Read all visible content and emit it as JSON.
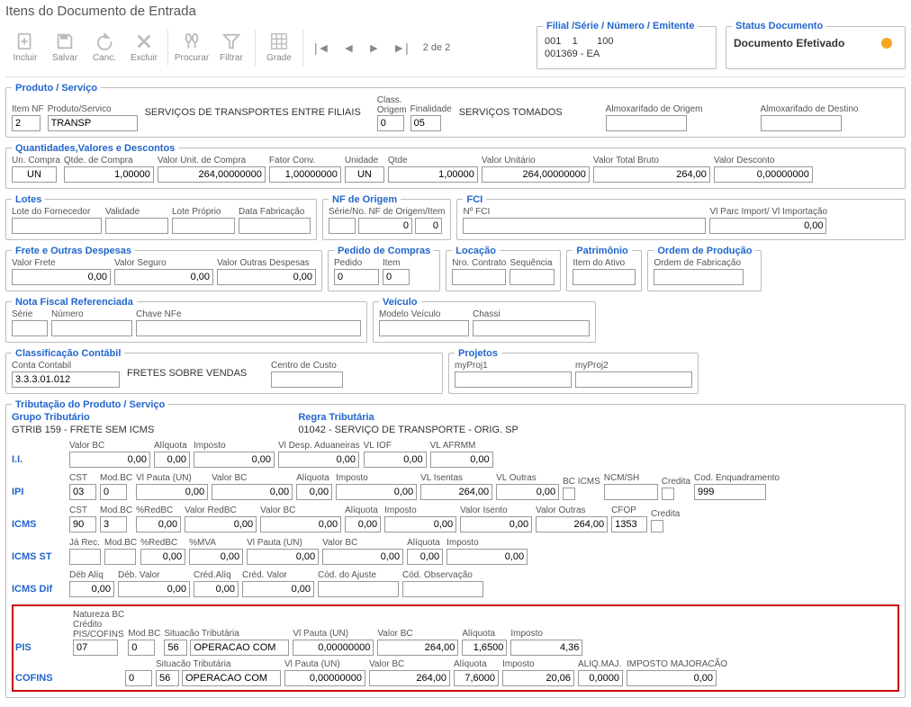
{
  "title": "Itens do Documento de Entrada",
  "toolbar": {
    "incluir": "Incluir",
    "salvar": "Salvar",
    "canc": "Canc.",
    "excluir": "Excluir",
    "procurar": "Procurar",
    "filtrar": "Filtrar",
    "grade": "Grade",
    "nav_count": "2 de 2"
  },
  "filial": {
    "legend": "Filial /Série / Número / Emitente",
    "line1_a": "001",
    "line1_b": "1",
    "line1_c": "100",
    "line2": "001369 - EA"
  },
  "status": {
    "legend": "Status Documento",
    "text": "Documento Efetivado"
  },
  "produto": {
    "legend": "Produto / Serviço",
    "item_nf_label": "Item NF",
    "item_nf": "2",
    "produto_label": "Produto/Servico",
    "produto": "TRANSP",
    "produto_desc": "SERVIÇOS DE TRANSPORTES ENTRE FILIAIS",
    "class_origem_label1": "Class.",
    "class_origem_label2": "Origem",
    "class_origem": "0",
    "finalidade_label": "Finalidade",
    "finalidade": "05",
    "finalidade_desc": "SERVIÇOS TOMADOS",
    "almox_origem_label": "Almoxarifado de Origem",
    "almox_origem": "",
    "almox_destino_label": "Almoxarifado de Destino",
    "almox_destino": ""
  },
  "qvd": {
    "legend": "Quantidades,Valores e Descontos",
    "un_compra_label": "Un. Compra",
    "un_compra": "UN",
    "qtde_compra_label": "Qtde. de Compra",
    "qtde_compra": "1,00000",
    "valor_unit_label": "Valor Unit. de Compra",
    "valor_unit": "264,00000000",
    "fator_conv_label": "Fator Conv.",
    "fator_conv": "1,00000000",
    "unidade_label": "Unidade",
    "unidade": "UN",
    "qtde_label": "Qtde",
    "qtde": "1,00000",
    "valor_unitario_label": "Valor Unitário",
    "valor_unitario": "264,00000000",
    "valor_total_label": "Valor Total Bruto",
    "valor_total": "264,00",
    "valor_desc_label": "Valor  Desconto",
    "valor_desc": "0,00000000"
  },
  "lotes": {
    "legend": "Lotes",
    "lote_forn_label": "Lote do Fornecedor",
    "validade_label": "Validade",
    "lote_proprio_label": "Lote Próprio",
    "data_fab_label": "Data Fabricação"
  },
  "nforigem": {
    "legend": "NF de Origem",
    "serie_no_label": "Série/No. NF de Origem/Item",
    "serie": "",
    "no": "0",
    "item": "0"
  },
  "fci": {
    "legend": "FCI",
    "nofci_label": "Nº FCI",
    "vlparc_label": "Vl Parc Import/ Vl Importação",
    "vlparc": "0,00"
  },
  "frete": {
    "legend": "Frete e Outras Despesas",
    "valor_frete_label": "Valor Frete",
    "valor_frete": "0,00",
    "valor_seguro_label": "Valor Seguro",
    "valor_seguro": "0,00",
    "valor_outras_label": "Valor Outras Despesas",
    "valor_outras": "0,00"
  },
  "pedido": {
    "legend": "Pedido de Compras",
    "pedido_label": "Pedido",
    "pedido": "0",
    "item_label": "Item",
    "item": "0"
  },
  "locacao": {
    "legend": "Locação",
    "nro_label": "Nro. Contrato",
    "seq_label": "Sequência"
  },
  "patrimonio": {
    "legend": "Patrimônio",
    "item_label": "Item do Ativo"
  },
  "ordemprod": {
    "legend": "Ordem de Produção",
    "ordem_label": "Ordem de Fabricação"
  },
  "nfref": {
    "legend": "Nota Fiscal Referenciada",
    "serie_label": "Série",
    "numero_label": "Número",
    "chave_label": "Chave NFe"
  },
  "veiculo": {
    "legend": "Veículo",
    "modelo_label": "Modelo Veículo",
    "chassi_label": "Chassi"
  },
  "classif": {
    "legend": "Classificação Contábil",
    "conta_label": "Conta Contabil",
    "conta": "3.3.3.01.012",
    "conta_desc": "FRETES SOBRE VENDAS",
    "centro_label": "Centro de Custo"
  },
  "projetos": {
    "legend": "Projetos",
    "p1_label": "myProj1",
    "p2_label": "myProj2"
  },
  "tributacao": {
    "legend": "Tributação do Produto / Serviço",
    "grupo_label": "Grupo Tributário",
    "grupo_value": "GTRIB 159 - FRETE SEM ICMS",
    "regra_label": "Regra Tributária",
    "regra_value": "01042 - SERVIÇO DE TRANSPORTE - ORIG. SP",
    "labels": {
      "valor_bc": "Valor BC",
      "aliquota": "Alíquota",
      "imposto": "Imposto",
      "vl_desp_aduan": "Vl Desp. Aduaneiras",
      "vl_iof": "VL IOF",
      "vl_afrmm": "VL AFRMM",
      "cst": "CST",
      "modbc": "Mod.BC",
      "vl_pauta": "Vl Pauta (UN)",
      "vl_isentas": "VL Isentas",
      "vl_outras": "VL Outras",
      "bc_icms": "BC ICMS",
      "ncm_sh": "NCM/SH",
      "credita": "Credita",
      "cod_enquadramento": "Cod. Enquadramento",
      "pct_redbc": "%RedBC",
      "valor_redbc": "Valor RedBC",
      "valor_isento": "Valor Isento",
      "valor_outras": "Valor Outras",
      "cfop": "CFOP",
      "ja_rec": "Já Rec.",
      "pct_mva": "%MVA",
      "deb_aliq": "Déb Alíq",
      "deb_valor": "Déb. Valor",
      "cred_aliq": "Créd.Alíq",
      "cred_valor": "Créd. Valor",
      "cod_ajuste": "Cód. do Ajuste",
      "cod_observacao": "Cód. Observação",
      "natureza_bc1": "Natureza BC",
      "natureza_bc2": "Crédito",
      "natureza_bc3": "PIS/COFINS",
      "situacao_trib": "Situacão Tributária",
      "aliq_maj": "ALIQ.MAJ.",
      "imposto_maj": "IMPOSTO MAJORACÃO"
    },
    "ii": {
      "name": "I.I.",
      "valor_bc": "0,00",
      "aliquota": "0,00",
      "imposto": "0,00",
      "desp_aduan": "0,00",
      "vl_iof": "0,00",
      "vl_afrmm": "0,00"
    },
    "ipi": {
      "name": "IPI",
      "cst": "03",
      "modbc": "0",
      "vl_pauta": "0,00",
      "valor_bc": "0,00",
      "aliquota": "0,00",
      "imposto": "0,00",
      "vl_isentas": "264,00",
      "vl_outras": "0,00",
      "bc_icms": "",
      "ncm_sh": "",
      "cod_enq": "999"
    },
    "icms": {
      "name": "ICMS",
      "cst": "90",
      "modbc": "3",
      "pct_redbc": "0,00",
      "valor_redbc": "0,00",
      "valor_bc": "0,00",
      "aliquota": "0,00",
      "imposto": "0,00",
      "valor_isento": "0,00",
      "valor_outras": "264,00",
      "cfop": "1353"
    },
    "icms_st": {
      "name": "ICMS ST",
      "ja_rec": "",
      "modbc": "",
      "pct_redbc": "0,00",
      "pct_mva": "0,00",
      "vl_pauta": "0,00",
      "valor_bc": "0,00",
      "aliquota": "0,00",
      "imposto": "0,00"
    },
    "icms_dif": {
      "name": "ICMS Dif",
      "deb_aliq": "0,00",
      "deb_valor": "0,00",
      "cred_aliq": "0,00",
      "cred_valor": "0,00",
      "cod_ajuste": "",
      "cod_obs": ""
    },
    "pis": {
      "name": "PIS",
      "natureza": "07",
      "modbc": "0",
      "sit_trib_cod": "56",
      "sit_trib_desc": "OPERACAO COM",
      "vl_pauta": "0,00000000",
      "valor_bc": "264,00",
      "aliquota": "1,6500",
      "imposto": "4,36"
    },
    "cofins": {
      "name": "COFINS",
      "modbc": "0",
      "sit_trib_cod": "56",
      "sit_trib_desc": "OPERACAO COM",
      "vl_pauta": "0,00000000",
      "valor_bc": "264,00",
      "aliquota": "7,6000",
      "imposto": "20,06",
      "aliq_maj": "0,0000",
      "imposto_maj": "0,00"
    }
  }
}
